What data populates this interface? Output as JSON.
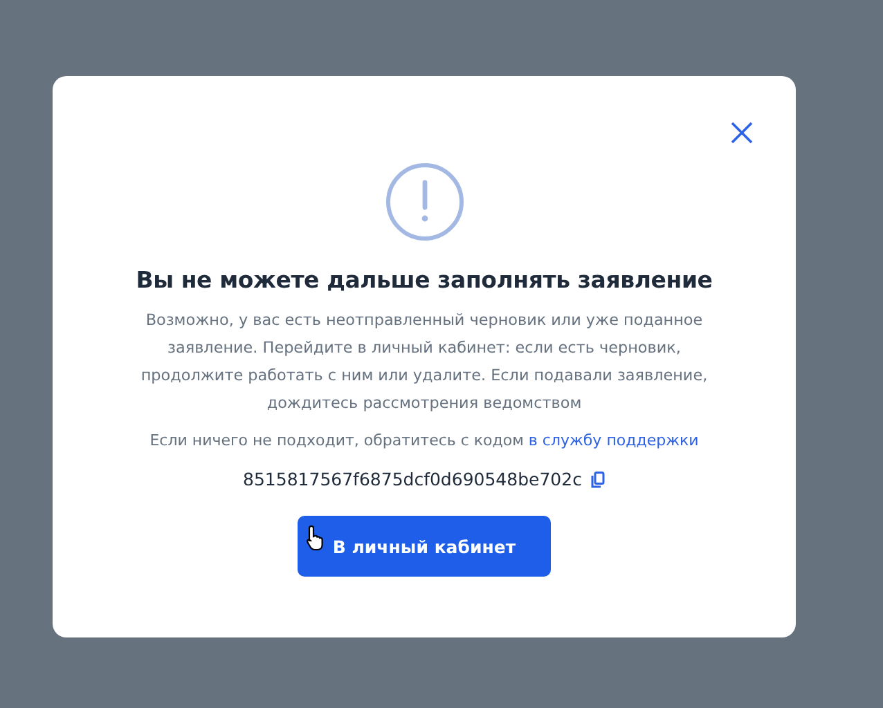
{
  "dialog": {
    "title": "Вы не можете дальше заполнять заявление",
    "message": "Возможно, у вас есть неотправленный черновик или уже поданное заявление. Перейдите в личный кабинет: если есть черновик, продолжите работать с ним или удалите. Если подавали заявление, дождитесь рассмотрения ведомством",
    "support_text": "Если ничего не подходит, обратитесь с кодом ",
    "support_link": "в службу поддержки",
    "code": "8515817567f6875dcf0d690548be702c",
    "button": "В личный кабинет"
  }
}
